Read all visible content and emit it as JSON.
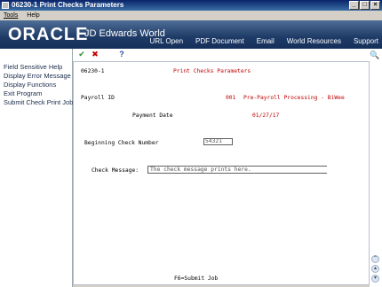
{
  "window": {
    "title": "06230-1   Print Checks Parameters",
    "controls": [
      "_",
      "□",
      "×"
    ]
  },
  "menubar": {
    "items": [
      "Tools",
      "Help"
    ]
  },
  "banner": {
    "oracle": "ORACLE",
    "product": "JD Edwards World",
    "links": [
      "URL Open",
      "PDF Document",
      "Email",
      "World Resources",
      "Support"
    ]
  },
  "sidebar": {
    "items": [
      "Field Sensitive Help",
      "Display Error Message",
      "Display Functions",
      "Exit Program",
      "Submit Check Print Job"
    ]
  },
  "toolbar": {
    "icons": [
      "check-icon",
      "cancel-icon",
      "help-icon"
    ]
  },
  "form": {
    "program_id": "06230-1",
    "screen_title": "Print Checks Parameters",
    "payroll_id_label": "Payroll ID",
    "payroll_id_value": "001",
    "payroll_id_desc": "Pre-Payroll Processing - BiWee",
    "payment_date_label": "Payment Date",
    "payment_date_value": "01/27/17",
    "beginning_check_label": "Beginning Check Number",
    "beginning_check_value": "54321",
    "check_message_label": "Check Message:",
    "check_message_value": "The check message prints here.",
    "footer": "F6=Submit Job"
  },
  "colors": {
    "accent_red": "#c00000",
    "banner": "#1e3a66"
  }
}
